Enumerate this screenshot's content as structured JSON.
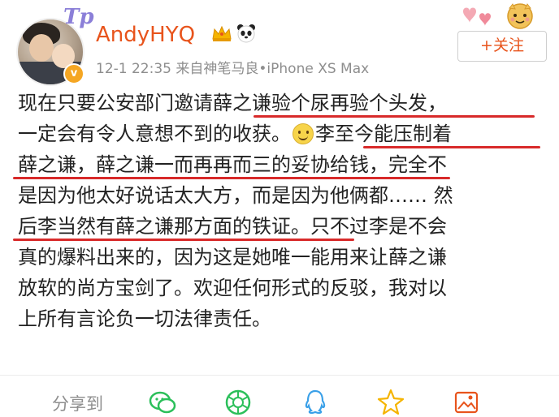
{
  "user": {
    "name": "AndyHYQ",
    "time": "12-1 22:35",
    "source": "来自神笔马良•iPhone XS Max",
    "avatar_badge": "v",
    "avatar_mark": "Tp"
  },
  "follow_button": {
    "label": "+关注"
  },
  "post": {
    "lines": [
      "现在只要公安部门邀请薛之谦验个尿再验个头发，",
      "一定会有令人意想不到的收获。",
      "薛之谦，薛之谦一而再再而三的妥协给钱，完全不",
      "是因为他太好说话太大方，而是因为他俩都…… 然",
      "后李当然有薛之谦那方面的铁证。只不过李是不会",
      "真的爆料出来的，因为这是她唯一能用来让薛之谦",
      "放软的尚方宝剑了。欢迎任何形式的反驳，我对以",
      "上所有言论负一切法律责任。"
    ],
    "line2_after_emoji": "李至今能压制着",
    "emoji": "smile-emoji"
  },
  "share": {
    "label": "分享到",
    "icons": [
      "wechat-icon",
      "moments-icon",
      "qq-icon",
      "qzone-icon",
      "gallery-icon"
    ]
  },
  "colors": {
    "accent": "#e8541c",
    "underline": "#d82a2a",
    "meta": "#8e8e8e"
  }
}
